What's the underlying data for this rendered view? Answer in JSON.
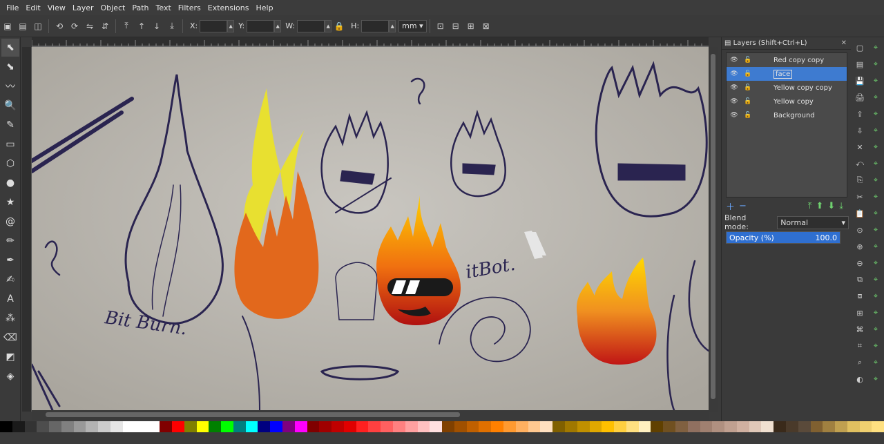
{
  "menu": [
    "File",
    "Edit",
    "View",
    "Layer",
    "Object",
    "Path",
    "Text",
    "Filters",
    "Extensions",
    "Help"
  ],
  "toolbar": {
    "x_label": "X:",
    "y_label": "Y:",
    "w_label": "W:",
    "h_label": "H:",
    "unit": "mm"
  },
  "layers_panel": {
    "title": "Layers (Shift+Ctrl+L)",
    "layers": [
      {
        "name": "Red copy copy",
        "selected": false
      },
      {
        "name": "face",
        "selected": true
      },
      {
        "name": "Yellow copy copy",
        "selected": false
      },
      {
        "name": "Yellow copy",
        "selected": false
      },
      {
        "name": "Background",
        "selected": false
      }
    ],
    "blend_label": "Blend mode:",
    "blend_value": "Normal",
    "opacity_label": "Opacity (%)",
    "opacity_value": "100.0"
  },
  "canvas_text": {
    "sketch_label_1": "Bit Burn.",
    "sketch_label_2": "itBot."
  },
  "icons": {
    "tools": [
      "selector-icon",
      "node-icon",
      "tweak-icon",
      "zoom-icon",
      "measure-icon",
      "rect-icon",
      "3dbox-icon",
      "ellipse-icon",
      "star-icon",
      "spiral-icon",
      "pencil-icon",
      "pen-icon",
      "calligraphy-icon",
      "text-icon",
      "spray-icon",
      "eraser-icon",
      "bucket-icon",
      "gradient-icon"
    ]
  },
  "colors": {
    "selection": "#3e7bd0",
    "flame_yellow": "#e8e030",
    "flame_orange": "#e2681c"
  },
  "palette": [
    "#000000",
    "#1a1a1a",
    "#333333",
    "#4d4d4d",
    "#666666",
    "#808080",
    "#999999",
    "#b3b3b3",
    "#cccccc",
    "#e6e6e6",
    "#ffffff",
    "#ffffff",
    "#ffffff",
    "#800000",
    "#ff0000",
    "#808000",
    "#ffff00",
    "#008000",
    "#00ff00",
    "#008080",
    "#00ffff",
    "#000080",
    "#0000ff",
    "#800080",
    "#ff00ff",
    "#800000",
    "#a00000",
    "#c00000",
    "#e00000",
    "#ff2020",
    "#ff4040",
    "#ff6060",
    "#ff8080",
    "#ffa0a0",
    "#ffc0c0",
    "#ffe0e0",
    "#804000",
    "#a05000",
    "#c06000",
    "#e07000",
    "#ff8000",
    "#ff9a30",
    "#ffb060",
    "#ffc890",
    "#ffe0c0",
    "#806000",
    "#a07800",
    "#c09000",
    "#e0a800",
    "#ffc000",
    "#ffd040",
    "#ffe080",
    "#fff0c0",
    "#604000",
    "#705020",
    "#806040",
    "#907060",
    "#a08070",
    "#b09080",
    "#c0a090",
    "#d0b0a0",
    "#e0c8b8",
    "#f0e0d0",
    "#3a2a1a",
    "#4a3a2a",
    "#5a4a3a",
    "#806030",
    "#a08040",
    "#c0a050",
    "#e0c060",
    "#f0d070",
    "#ffe080"
  ]
}
